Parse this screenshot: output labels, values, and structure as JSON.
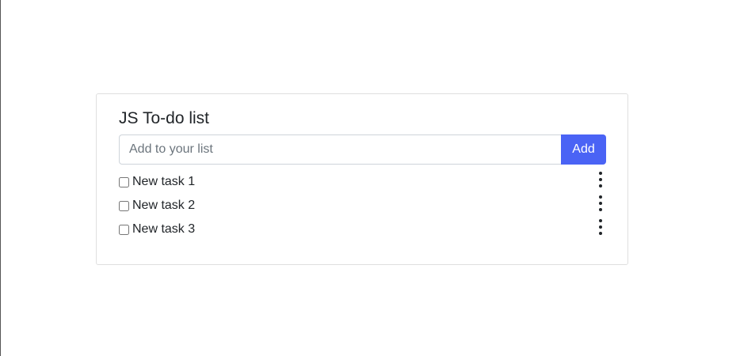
{
  "app": {
    "title": "JS To-do list"
  },
  "form": {
    "input_value": "",
    "input_placeholder": "Add to your list",
    "add_label": "Add"
  },
  "tasks": [
    {
      "label": "New task 1",
      "checked": false,
      "menu_icon": "more-vertical-icon"
    },
    {
      "label": "New task 2",
      "checked": false,
      "menu_icon": "more-vertical-icon"
    },
    {
      "label": "New task 3",
      "checked": false,
      "menu_icon": "more-vertical-icon"
    }
  ],
  "colors": {
    "accent": "#4a63f5",
    "border": "#dfdfdf",
    "text": "#212529",
    "placeholder": "#6c757d"
  }
}
